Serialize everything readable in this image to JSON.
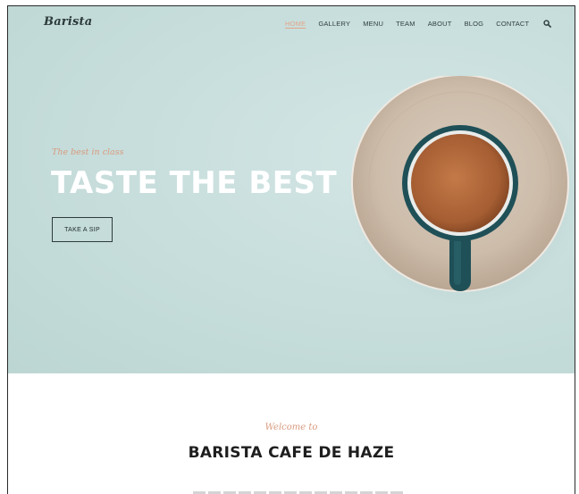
{
  "brand": {
    "logo": "Barista"
  },
  "nav": {
    "items": [
      {
        "label": "HOME",
        "active": true
      },
      {
        "label": "GALLERY",
        "active": false
      },
      {
        "label": "MENU",
        "active": false
      },
      {
        "label": "TEAM",
        "active": false
      },
      {
        "label": "ABOUT",
        "active": false
      },
      {
        "label": "BLOG",
        "active": false
      },
      {
        "label": "CONTACT",
        "active": false
      }
    ],
    "search_icon": "search-icon"
  },
  "hero": {
    "tagline": "The best in class",
    "title": "TASTE THE BEST",
    "cta_label": "TAKE A SIP"
  },
  "intro": {
    "kicker": "Welcome to",
    "title": "BARISTA CAFE DE HAZE"
  },
  "colors": {
    "accent": "#d99a7e",
    "hero_background": "#c6dddb",
    "text_dark": "#1e1e1e",
    "cup_teal": "#1f5057"
  }
}
